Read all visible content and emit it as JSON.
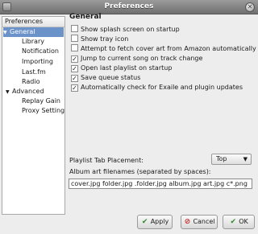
{
  "window": {
    "title": "Preferences"
  },
  "sidebar": {
    "header": "Preferences",
    "items": [
      {
        "label": "General",
        "expander": "▼",
        "selected": true
      },
      {
        "label": "Library"
      },
      {
        "label": "Notification"
      },
      {
        "label": "Importing"
      },
      {
        "label": "Last.fm"
      },
      {
        "label": "Radio"
      },
      {
        "label": "Advanced",
        "expander": "▼"
      },
      {
        "label": "Replay Gain"
      },
      {
        "label": "Proxy Settings"
      }
    ]
  },
  "panel": {
    "title": "General",
    "checkboxes": [
      {
        "label": "Show splash screen on startup",
        "checked": false
      },
      {
        "label": "Show tray icon",
        "checked": false
      },
      {
        "label": "Attempt to fetch cover art from Amazon automatically",
        "checked": false
      },
      {
        "label": "Jump to current song on track change",
        "checked": true
      },
      {
        "label": "Open last playlist on startup",
        "checked": true
      },
      {
        "label": "Save queue status",
        "checked": true
      },
      {
        "label": "Automatically check for Exaile and plugin updates",
        "checked": true
      }
    ],
    "tab_placement": {
      "label": "Playlist Tab Placement:",
      "value": "Top"
    },
    "album_art": {
      "label": "Album art filenames (separated by spaces):",
      "value": "cover.jpg folder.jpg .folder.jpg album.jpg art.jpg c*.png"
    }
  },
  "buttons": {
    "apply": {
      "label": "Apply",
      "icon": "check-icon"
    },
    "cancel": {
      "label": "Cancel",
      "icon": "cancel-icon"
    },
    "ok": {
      "label": "OK",
      "icon": "check-icon"
    }
  }
}
